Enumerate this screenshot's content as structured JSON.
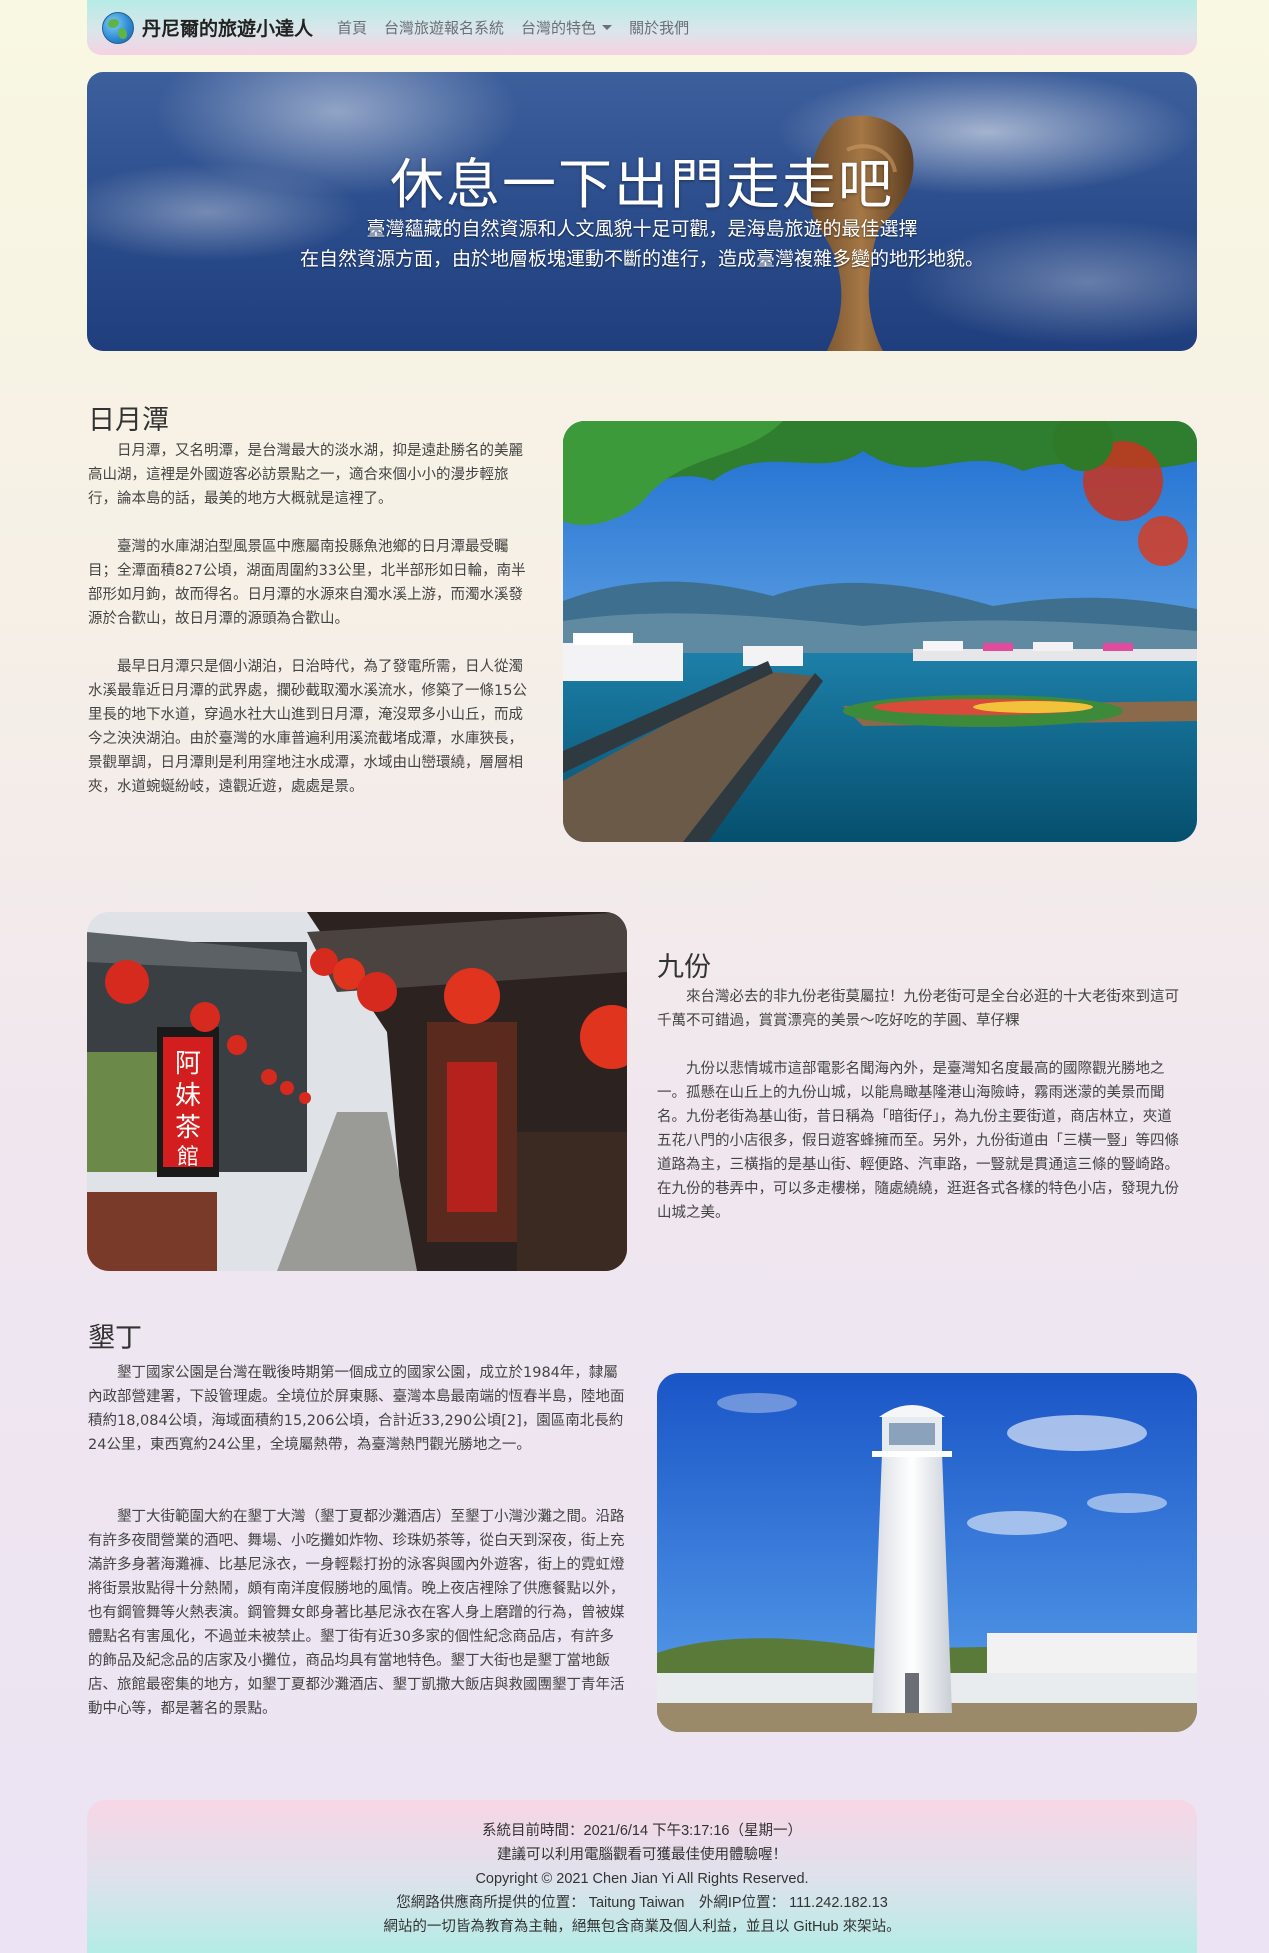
{
  "navbar": {
    "brand": "丹尼爾的旅遊小達人",
    "links": [
      "首頁",
      "台灣旅遊報名系統",
      "台灣的特色",
      "關於我們"
    ]
  },
  "hero": {
    "title": "休息一下出門走走吧",
    "line1": "臺灣蘊藏的自然資源和人文風貌十足可觀，是海島旅遊的最佳選擇",
    "line2": "在自然資源方面，由於地層板塊運動不斷的進行，造成臺灣複雜多變的地形地貌。"
  },
  "sun_moon_lake": {
    "title": "日月潭",
    "p1": "日月潭，又名明潭，是台灣最大的淡水湖，抑是遠赴勝名的美麗高山湖，這裡是外國遊客必訪景點之一，適合來個小小的漫步輕旅行，論本島的話，最美的地方大概就是這裡了。",
    "p2": "臺灣的水庫湖泊型風景區中應屬南投縣魚池鄉的日月潭最受矚目；全潭面積827公頃，湖面周圍約33公里，北半部形如日輪，南半部形如月鉤，故而得名。日月潭的水源來自濁水溪上游，而濁水溪發源於合歡山，故日月潭的源頭為合歡山。",
    "p3": "最早日月潭只是個小湖泊，日治時代，為了發電所需，日人從濁水溪最靠近日月潭的武界處，攔砂截取濁水溪流水，修築了一條15公里長的地下水道，穿過水社大山進到日月潭，淹沒眾多小山丘，而成今之泱泱湖泊。由於臺灣的水庫普遍利用溪流截堵成潭，水庫狹長，景觀單調，日月潭則是利用窪地注水成潭，水域由山巒環繞，層層相夾，水道蜿蜒紛岐，遠觀近遊，處處是景。"
  },
  "jiufen": {
    "title": "九份",
    "p1": "來台灣必去的非九份老街莫屬拉！九份老街可是全台必逛的十大老街來到這可千萬不可錯過，賞賞漂亮的美景～吃好吃的芋圓、草仔粿",
    "p2": "九份以悲情城市這部電影名聞海內外，是臺灣知名度最高的國際觀光勝地之一。孤懸在山丘上的九份山城，以能鳥瞰基隆港山海險峙，霧雨迷濛的美景而聞名。九份老街為基山街，昔日稱為「暗街仔」，為九份主要街道，商店林立，夾道五花八門的小店很多，假日遊客蜂擁而至。另外，九份街道由「三橫一豎」等四條道路為主，三橫指的是基山街、輕便路、汽車路，一豎就是貫通這三條的豎崎路。在九份的巷弄中，可以多走樓梯，隨處繞繞，逛逛各式各樣的特色小店，發現九份山城之美。",
    "sign": "阿妹茶酒館"
  },
  "kenting": {
    "title": "墾丁",
    "p1": "墾丁國家公園是台灣在戰後時期第一個成立的國家公園，成立於1984年，隸屬內政部營建署，下設管理處。全境位於屏東縣、臺灣本島最南端的恆春半島，陸地面積約18,084公頃，海域面積約15,206公頃，合計近33,290公頃[2]，園區南北長約24公里，東西寬約24公里，全境屬熱帶，為臺灣熱門觀光勝地之一。",
    "p2": "墾丁大街範圍大約在墾丁大灣（墾丁夏都沙灘酒店）至墾丁小灣沙灘之間。沿路有許多夜間營業的酒吧、舞場、小吃攤如炸物、珍珠奶茶等，從白天到深夜，街上充滿許多身著海灘褲、比基尼泳衣，一身輕鬆打扮的泳客與國內外遊客，街上的霓虹燈將街景妝點得十分熱鬧，頗有南洋度假勝地的風情。晚上夜店裡除了供應餐點以外，也有鋼管舞等火熱表演。鋼管舞女郎身著比基尼泳衣在客人身上磨蹭的行為，曾被媒體點名有害風化，不過並未被禁止。墾丁街有近30多家的個性紀念商品店，有許多的飾品及紀念品的店家及小攤位，商品均具有當地特色。墾丁大街也是墾丁當地飯店、旅館最密集的地方，如墾丁夏都沙灘酒店、墾丁凱撒大飯店與救國團墾丁青年活動中心等，都是著名的景點。"
  },
  "footer": {
    "time": "系統目前時間：2021/6/14 下午3:17:16（星期一）",
    "advice": "建議可以利用電腦觀看可獲最佳使用體驗喔！",
    "copyright": "Copyright © 2021 Chen Jian Yi All Rights Reserved.",
    "location": "您網路供應商所提供的位置： Taitung Taiwan　外網IP位置： 111.242.182.13",
    "note": "網站的一切皆為教育為主軸，絕無包含商業及個人利益，並且以 GitHub 來架站。"
  }
}
